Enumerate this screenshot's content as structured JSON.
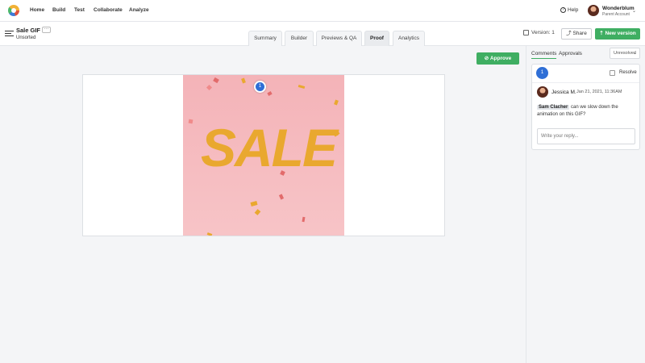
{
  "nav": {
    "items": [
      {
        "label": "Home",
        "name": "nav-home"
      },
      {
        "label": "Build",
        "name": "nav-build"
      },
      {
        "label": "Test",
        "name": "nav-test"
      },
      {
        "label": "Collaborate",
        "name": "nav-collaborate"
      },
      {
        "label": "Analyze",
        "name": "nav-analyze"
      }
    ],
    "help_label": "Help",
    "account": {
      "name": "Wonderblum",
      "sub": "Parent Account"
    }
  },
  "document": {
    "title": "Sale GIF",
    "folder": "Unsorted",
    "more_label": "···"
  },
  "tabs": [
    {
      "label": "Summary"
    },
    {
      "label": "Builder"
    },
    {
      "label": "Previews & QA"
    },
    {
      "label": "Proof",
      "active": true
    },
    {
      "label": "Analytics"
    }
  ],
  "toolbar": {
    "version_label": "Version: 1",
    "share_label": "Share",
    "new_version_label": "New version",
    "approve_label": "Approve"
  },
  "canvas": {
    "gif_text": "SALE",
    "pin_number": "1"
  },
  "panel": {
    "tabs": [
      {
        "label": "Comments",
        "active": true
      },
      {
        "label": "Approvals"
      }
    ],
    "filter_label": "Unresolved",
    "comment": {
      "number": "1",
      "resolve_label": "Resolve",
      "author": "Jessica M.",
      "date": "Jan 21, 2021, 11:36AM",
      "mention": "Sam Clacher",
      "text": "can we slow down the animation on this GIF?",
      "reply_placeholder": "Write your reply..."
    }
  },
  "colors": {
    "accent_green": "#3fae62",
    "pin_blue": "#2f6fd6",
    "gif_pink": "#f4b3b8",
    "sale_gold": "#e9a82f"
  }
}
